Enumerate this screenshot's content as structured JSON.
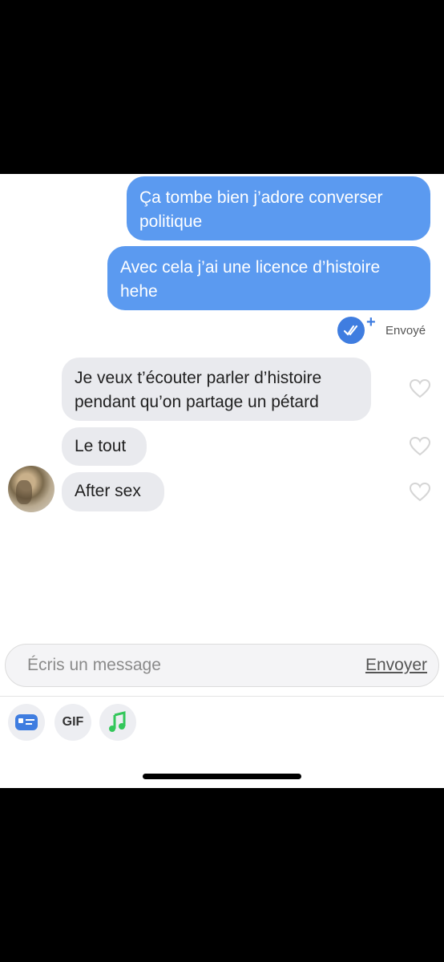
{
  "messages": [
    {
      "text": "Ça tombe bien j’adore converser politique",
      "direction": "outgoing"
    },
    {
      "text": "Avec cela j’ai une licence d’histoire hehe",
      "direction": "outgoing"
    },
    {
      "text": "Je veux t’écouter parler d’histoire pendant qu’on partage un pétard",
      "direction": "incoming"
    },
    {
      "text": "Le tout",
      "direction": "incoming"
    },
    {
      "text": "After sex",
      "direction": "incoming"
    }
  ],
  "status": {
    "label": "Envoyé"
  },
  "composer": {
    "placeholder": "Écris un message",
    "send_label": "Envoyer"
  },
  "toolbar": {
    "gif_label": "GIF"
  },
  "colors": {
    "outgoing": "#5b9af0",
    "incoming": "#e9eaee",
    "accent": "#3f7de0",
    "music": "#33c75a"
  }
}
